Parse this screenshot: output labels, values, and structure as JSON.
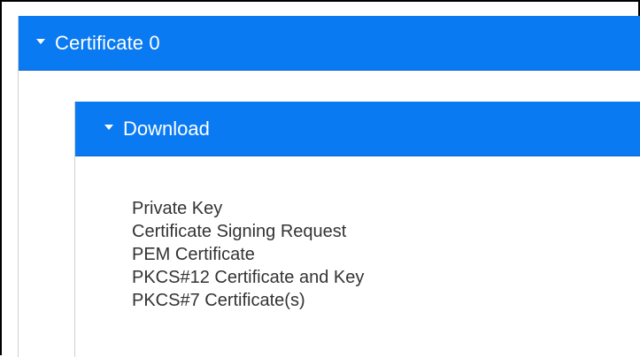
{
  "outer_panel": {
    "title": "Certificate 0",
    "toggle_icon": "caret-down-icon"
  },
  "inner_panel": {
    "title": "Download",
    "toggle_icon": "caret-down-icon",
    "items": [
      {
        "label": "Private Key"
      },
      {
        "label": "Certificate Signing Request"
      },
      {
        "label": "PEM Certificate"
      },
      {
        "label": "PKCS#12 Certificate and Key"
      },
      {
        "label": "PKCS#7 Certificate(s)"
      }
    ]
  },
  "colors": {
    "header_blue": "#0a7af2",
    "text_dark": "#333333"
  }
}
